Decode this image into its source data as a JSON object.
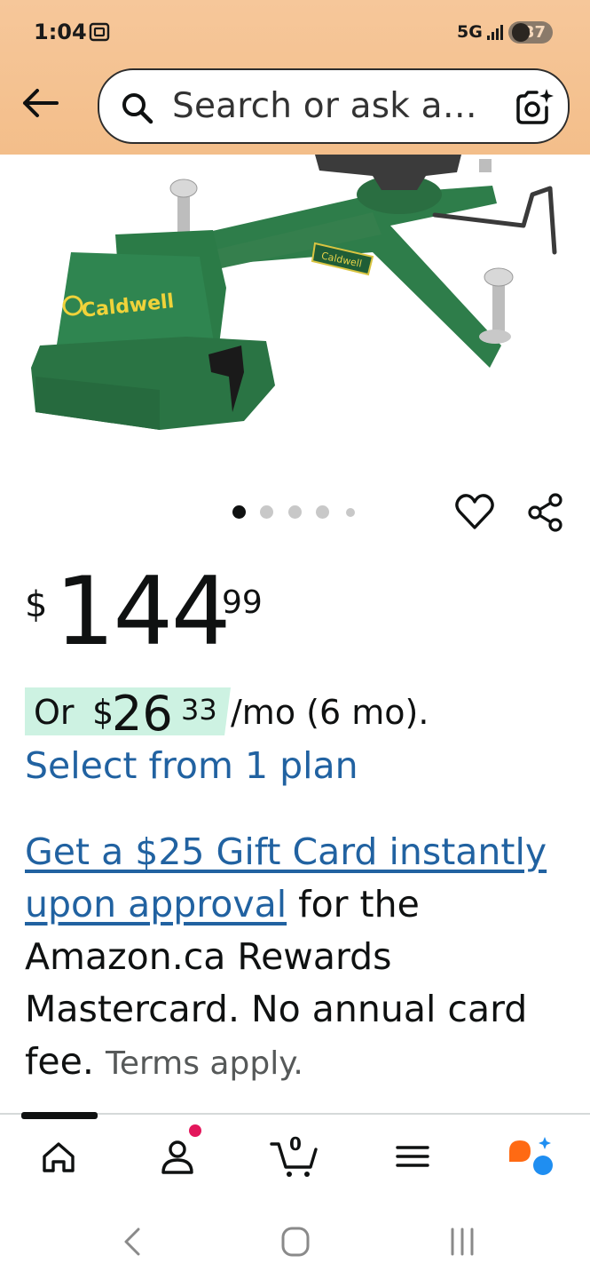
{
  "status_bar": {
    "time": "1:04",
    "network": "5G",
    "battery": "37"
  },
  "search": {
    "placeholder": "Search or ask a…"
  },
  "product": {
    "image_alt": "Caldwell shooting rest",
    "brand_logo_text": "Caldwell",
    "carousel": {
      "count": 5,
      "active_index": 0
    }
  },
  "price": {
    "symbol": "$",
    "whole": "144",
    "fraction": "99"
  },
  "installment": {
    "prefix": "Or",
    "symbol": "$",
    "whole": "26",
    "fraction": "33",
    "suffix": "/mo (6 mo).",
    "plan_link": "Select from 1 plan"
  },
  "promo": {
    "link_text": "Get a $25 Gift Card instantly upon approval",
    "body_text": " for the Amazon.ca Rewards Mastercard. No annual card fee.",
    "terms": "Terms apply."
  },
  "bottom_nav": {
    "cart_count": "0",
    "items": [
      "home",
      "profile",
      "cart",
      "menu",
      "rufus"
    ]
  },
  "colors": {
    "header_bg": "#f3be8a",
    "link": "#2162a1",
    "installment_highlight": "#cdf2e2",
    "product_green": "#2e7d4a",
    "profile_badge": "#e3165b",
    "rufus_orange": "#ff6a13",
    "rufus_blue": "#1f8ef1"
  }
}
